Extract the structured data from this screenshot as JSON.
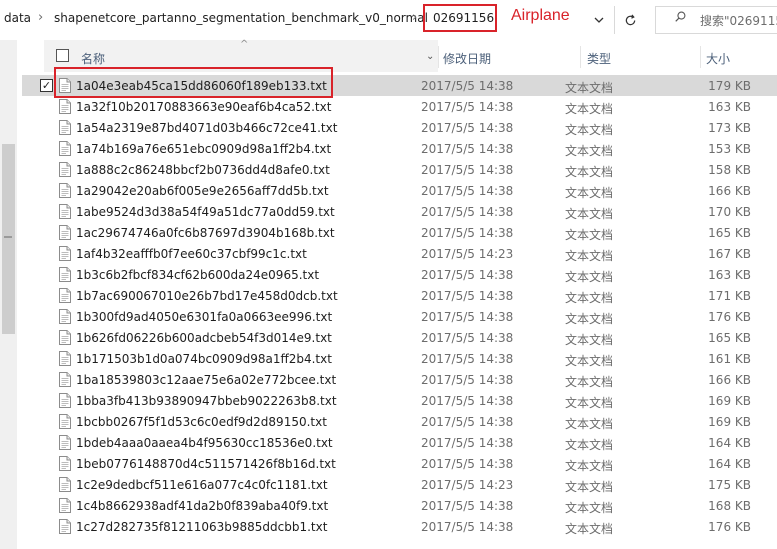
{
  "address_bar": {
    "breadcrumbs": [
      "data",
      "shapenetcore_partanno_segmentation_benchmark_v0_normal",
      "02691156"
    ],
    "separator": "›",
    "annotation": "Airplane",
    "search_placeholder": "搜索\"02691156\""
  },
  "columns": {
    "name": "名称",
    "date": "修改日期",
    "type": "类型",
    "size": "大小"
  },
  "files": [
    {
      "name": "1a04e3eab45ca15dd86060f189eb133.txt",
      "date": "2017/5/5 14:38",
      "type": "文本文档",
      "size": "179 KB",
      "selected": true
    },
    {
      "name": "1a32f10b20170883663e90eaf6b4ca52.txt",
      "date": "2017/5/5 14:38",
      "type": "文本文档",
      "size": "163 KB"
    },
    {
      "name": "1a54a2319e87bd4071d03b466c72ce41.txt",
      "date": "2017/5/5 14:38",
      "type": "文本文档",
      "size": "173 KB"
    },
    {
      "name": "1a74b169a76e651ebc0909d98a1ff2b4.txt",
      "date": "2017/5/5 14:38",
      "type": "文本文档",
      "size": "153 KB"
    },
    {
      "name": "1a888c2c86248bbcf2b0736dd4d8afe0.txt",
      "date": "2017/5/5 14:38",
      "type": "文本文档",
      "size": "158 KB"
    },
    {
      "name": "1a29042e20ab6f005e9e2656aff7dd5b.txt",
      "date": "2017/5/5 14:38",
      "type": "文本文档",
      "size": "166 KB"
    },
    {
      "name": "1abe9524d3d38a54f49a51dc77a0dd59.txt",
      "date": "2017/5/5 14:38",
      "type": "文本文档",
      "size": "170 KB"
    },
    {
      "name": "1ac29674746a0fc6b87697d3904b168b.txt",
      "date": "2017/5/5 14:38",
      "type": "文本文档",
      "size": "165 KB"
    },
    {
      "name": "1af4b32eafffb0f7ee60c37cbf99c1c.txt",
      "date": "2017/5/5 14:23",
      "type": "文本文档",
      "size": "167 KB"
    },
    {
      "name": "1b3c6b2fbcf834cf62b600da24e0965.txt",
      "date": "2017/5/5 14:38",
      "type": "文本文档",
      "size": "163 KB"
    },
    {
      "name": "1b7ac690067010e26b7bd17e458d0dcb.txt",
      "date": "2017/5/5 14:38",
      "type": "文本文档",
      "size": "171 KB"
    },
    {
      "name": "1b300fd9ad4050e6301fa0a0663ee996.txt",
      "date": "2017/5/5 14:38",
      "type": "文本文档",
      "size": "176 KB"
    },
    {
      "name": "1b626fd06226b600adcbeb54f3d014e9.txt",
      "date": "2017/5/5 14:38",
      "type": "文本文档",
      "size": "165 KB"
    },
    {
      "name": "1b171503b1d0a074bc0909d98a1ff2b4.txt",
      "date": "2017/5/5 14:38",
      "type": "文本文档",
      "size": "161 KB"
    },
    {
      "name": "1ba18539803c12aae75e6a02e772bcee.txt",
      "date": "2017/5/5 14:38",
      "type": "文本文档",
      "size": "166 KB"
    },
    {
      "name": "1bba3fb413b93890947bbeb9022263b8.txt",
      "date": "2017/5/5 14:38",
      "type": "文本文档",
      "size": "169 KB"
    },
    {
      "name": "1bcbb0267f5f1d53c6c0edf9d2d89150.txt",
      "date": "2017/5/5 14:38",
      "type": "文本文档",
      "size": "169 KB"
    },
    {
      "name": "1bdeb4aaa0aaea4b4f95630cc18536e0.txt",
      "date": "2017/5/5 14:38",
      "type": "文本文档",
      "size": "164 KB"
    },
    {
      "name": "1beb0776148870d4c511571426f8b16d.txt",
      "date": "2017/5/5 14:38",
      "type": "文本文档",
      "size": "164 KB"
    },
    {
      "name": "1c2e9dedbcf511e616a077c4c0fc1181.txt",
      "date": "2017/5/5 14:23",
      "type": "文本文档",
      "size": "175 KB"
    },
    {
      "name": "1c4b8662938adf41da2b0f839aba40f9.txt",
      "date": "2017/5/5 14:38",
      "type": "文本文档",
      "size": "168 KB"
    },
    {
      "name": "1c27d282735f81211063b9885ddcbb1.txt",
      "date": "2017/5/5 14:38",
      "type": "文本文档",
      "size": "176 KB"
    }
  ]
}
